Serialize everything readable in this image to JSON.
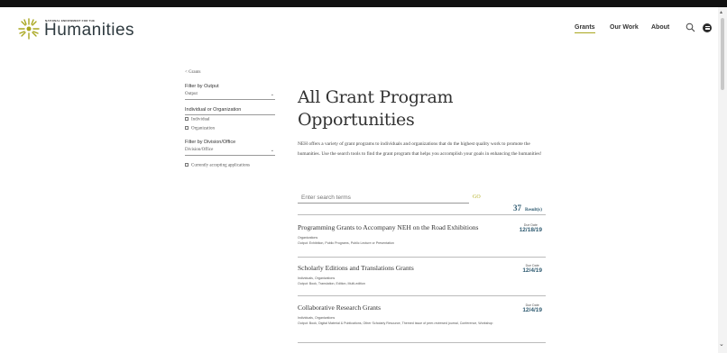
{
  "header": {
    "logo_small_text": "NATIONAL ENDOWMENT FOR THE",
    "logo_text": "Humanities",
    "nav": [
      "Grants",
      "Our Work",
      "About"
    ]
  },
  "filters": {
    "back_link": "< Grants",
    "output_label": "Filter by Output",
    "output_value": "Output",
    "individual_label": "Individual or Organization",
    "individual_option": "Individual",
    "organization_option": "Organization",
    "division_label": "Filter by Division/Office",
    "division_value": "Division/Office",
    "accepting_label": "Currently accepting applications"
  },
  "main": {
    "title": "All Grant Program Opportunities",
    "intro": "NEH offers a variety of grant programs to individuals and organizations that do the highest quality work to promote the humanities. Use the search tools to find the grant program that helps you accomplish your goals in enhancing the humanities!",
    "search_placeholder": "Enter search terms",
    "go_label": "GO",
    "results_count": "37",
    "results_label": "Result(s)"
  },
  "due_label": "Due Date",
  "grants": [
    {
      "title": "Programming Grants to Accompany NEH on the Road Exhibitions",
      "line1": "Organizations",
      "line2": "Output: Exhibition, Public Programs, Public Lecture or Presentation",
      "due": "12/18/19"
    },
    {
      "title": "Scholarly Editions and Translations Grants",
      "line1": "Individuals, Organizations",
      "line2": "Output: Book, Translation, Edition, Multi-edition",
      "due": "12/4/19"
    },
    {
      "title": "Collaborative Research Grants",
      "line1": "Individuals, Organizations",
      "line2": "Output: Book, Digital Material & Publications, Other Scholarly Resource, Themed issue of peer-reviewed journal, Conference, Workshop",
      "due": "12/4/19"
    }
  ],
  "colors": {
    "accent": "#a9a61e",
    "results_blue": "#2f5b71"
  }
}
